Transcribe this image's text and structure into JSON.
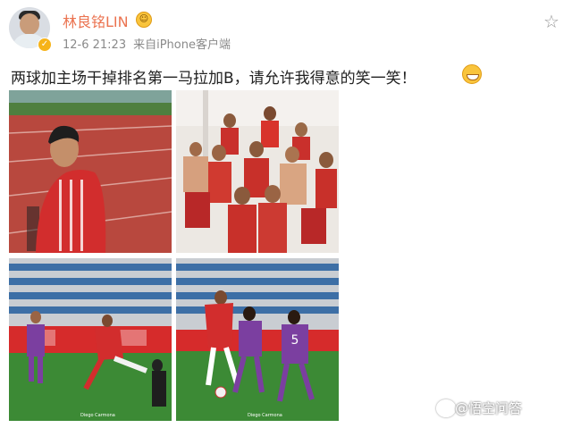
{
  "post": {
    "username": "林良铭LIN",
    "timestamp": "12-6 21:23",
    "source": "来自iPhone客户端",
    "text": "两球加主场干掉排名第一马拉加B，请允许我得意的笑一笑！",
    "photos": [
      {
        "credit": ""
      },
      {
        "credit": ""
      },
      {
        "credit": "Diego Carmona"
      },
      {
        "credit": "Diego Carmona"
      }
    ]
  },
  "watermark": "@悟空问答",
  "colors": {
    "username": "#eb7350",
    "meta": "#8a8a8a",
    "verified_badge": "#f6b319"
  },
  "icons": [
    "verified-badge-icon",
    "star-icon",
    "grin-emoji-icon"
  ]
}
